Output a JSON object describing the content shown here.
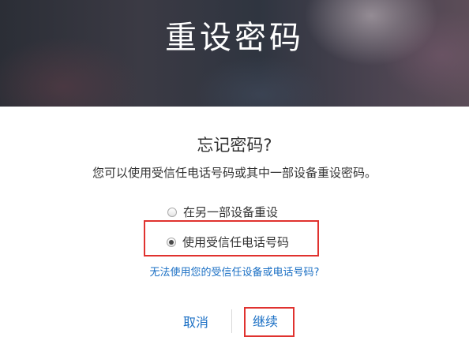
{
  "header": {
    "title": "重设密码"
  },
  "main": {
    "heading": "忘记密码?",
    "subtitle": "您可以使用受信任电话号码或其中一部设备重设密码。",
    "options": [
      {
        "label": "在另一部设备重设",
        "selected": false
      },
      {
        "label": "使用受信任电话号码",
        "selected": true
      }
    ],
    "trouble_link": "无法使用您的受信任设备或电话号码?"
  },
  "actions": {
    "cancel_label": "取消",
    "continue_label": "继续"
  },
  "colors": {
    "link": "#1a6fc4",
    "annotation_red": "#e0322f",
    "text": "#333333"
  }
}
